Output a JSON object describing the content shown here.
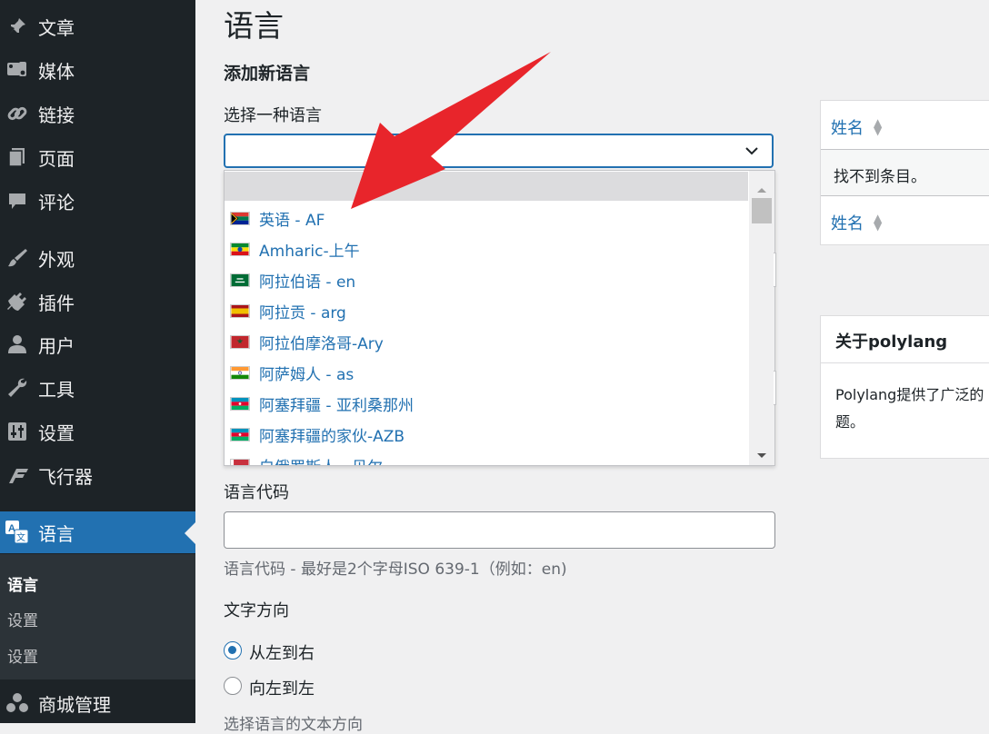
{
  "sidebar": {
    "items": [
      {
        "label": "文章",
        "icon": "pin-icon"
      },
      {
        "label": "媒体",
        "icon": "media-icon"
      },
      {
        "label": "链接",
        "icon": "link-icon"
      },
      {
        "label": "页面",
        "icon": "page-icon"
      },
      {
        "label": "评论",
        "icon": "comment-icon"
      },
      {
        "label": "外观",
        "icon": "brush-icon"
      },
      {
        "label": "插件",
        "icon": "plugin-icon"
      },
      {
        "label": "用户",
        "icon": "user-icon"
      },
      {
        "label": "工具",
        "icon": "wrench-icon"
      },
      {
        "label": "设置",
        "icon": "settings-icon"
      },
      {
        "label": "飞行器",
        "icon": "flyer-icon"
      },
      {
        "label": "语言",
        "icon": "translate-icon",
        "active": true
      },
      {
        "label": "商城管理",
        "icon": "store-icon"
      }
    ],
    "submenu": [
      "语言",
      "设置",
      "设置"
    ]
  },
  "main": {
    "title": "语言",
    "section_title": "添加新语言",
    "choose_label": "选择一种语言",
    "select_value": "",
    "dropdown_options": [
      {
        "label": "英语 - AF",
        "flag": "za"
      },
      {
        "label": "Amharic-上午",
        "flag": "et"
      },
      {
        "label": "阿拉伯语 - en",
        "flag": "sa"
      },
      {
        "label": "阿拉贡 - arg",
        "flag": "es"
      },
      {
        "label": "阿拉伯摩洛哥-Ary",
        "flag": "ma"
      },
      {
        "label": "阿萨姆人 - as",
        "flag": "in"
      },
      {
        "label": "阿塞拜疆 - 亚利桑那州",
        "flag": "az"
      },
      {
        "label": "阿塞拜疆的家伙-AZB",
        "flag": "az"
      },
      {
        "label": "白俄罗斯人 - 贝尔",
        "flag": "by"
      }
    ],
    "code_label": "语言代码",
    "code_value": "",
    "code_hint": "语言代码 - 最好是2个字母ISO 639-1（例如：en)",
    "direction_label": "文字方向",
    "direction_options": [
      "从左到右",
      "向左到左"
    ],
    "direction_selected": 0,
    "direction_hint": "选择语言的文本方向"
  },
  "table": {
    "col_name": "姓名",
    "empty": "找不到条目。",
    "col_name_footer": "姓名"
  },
  "about": {
    "title": "关于polylang",
    "body_line1": "Polylang提供了广泛的",
    "body_line2": "题。"
  },
  "colors": {
    "accent": "#2271b1",
    "arrow": "#e8252b",
    "sidebar": "#1d2327"
  }
}
